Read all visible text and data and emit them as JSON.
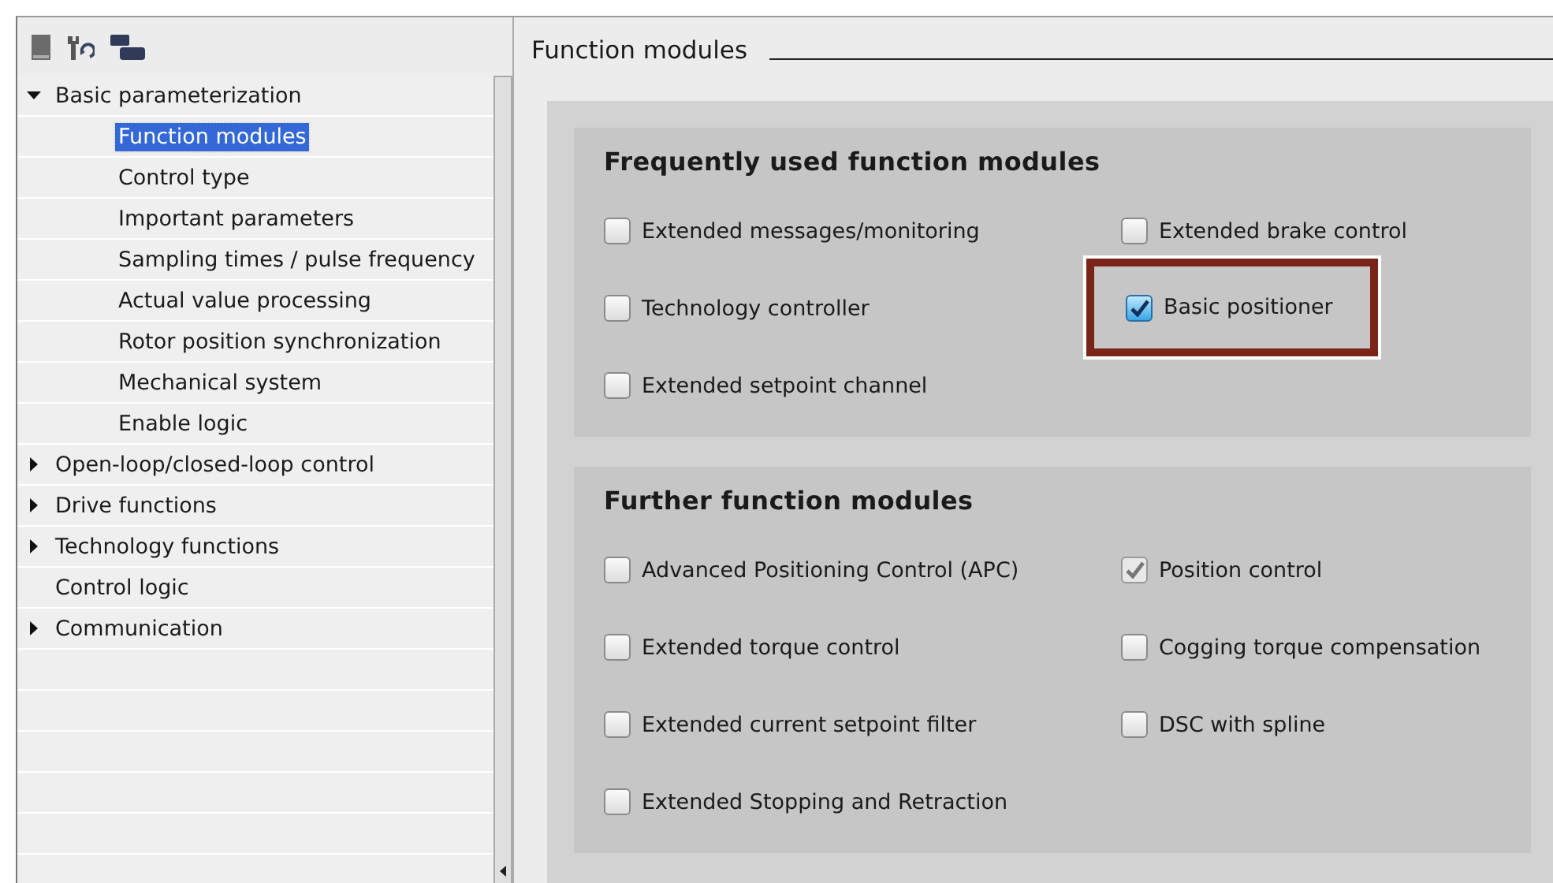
{
  "toolbar": {
    "buttons": [
      {
        "kind": "card"
      },
      {
        "kind": "wrench"
      },
      {
        "kind": "blocks"
      }
    ]
  },
  "tree": {
    "items": [
      {
        "label": "Basic parameterization",
        "expanded": true,
        "selected": false,
        "children": [
          {
            "label": "Function modules",
            "selected": true
          },
          {
            "label": "Control type",
            "selected": false
          },
          {
            "label": "Important parameters",
            "selected": false
          },
          {
            "label": "Sampling times / pulse frequency",
            "selected": false
          },
          {
            "label": "Actual value processing",
            "selected": false
          },
          {
            "label": "Rotor position synchronization",
            "selected": false
          },
          {
            "label": "Mechanical system",
            "selected": false
          },
          {
            "label": "Enable logic",
            "selected": false
          }
        ]
      },
      {
        "label": "Open-loop/closed-loop control",
        "expanded": false,
        "selected": false
      },
      {
        "label": "Drive functions",
        "expanded": false,
        "selected": false
      },
      {
        "label": "Technology functions",
        "expanded": false,
        "selected": false
      },
      {
        "label": "Control logic",
        "selected": false
      },
      {
        "label": "Communication",
        "expanded": false,
        "selected": false
      }
    ]
  },
  "section_title": "Function modules",
  "groups": [
    {
      "title": "Frequently used function modules",
      "options": [
        {
          "label": "Extended messages/monitoring",
          "checked": false,
          "disabled": false,
          "highlighted": false
        },
        {
          "label": "Extended brake control",
          "checked": false,
          "disabled": false,
          "highlighted": false
        },
        {
          "label": "Technology controller",
          "checked": false,
          "disabled": false,
          "highlighted": false
        },
        {
          "label": "Basic positioner",
          "checked": true,
          "disabled": false,
          "highlighted": true
        },
        {
          "label": "Extended setpoint channel",
          "checked": false,
          "disabled": false,
          "highlighted": false
        }
      ]
    },
    {
      "title": "Further function modules",
      "options": [
        {
          "label": "Advanced Positioning Control (APC)",
          "checked": false,
          "disabled": false,
          "highlighted": false
        },
        {
          "label": "Position control",
          "checked": true,
          "disabled": true,
          "highlighted": false
        },
        {
          "label": "Extended torque control",
          "checked": false,
          "disabled": false,
          "highlighted": false
        },
        {
          "label": "Cogging torque compensation",
          "checked": false,
          "disabled": false,
          "highlighted": false
        },
        {
          "label": "Extended current setpoint filter",
          "checked": false,
          "disabled": false,
          "highlighted": false
        },
        {
          "label": "DSC with spline",
          "checked": false,
          "disabled": false,
          "highlighted": false
        },
        {
          "label": "Extended Stopping and Retraction",
          "checked": false,
          "disabled": false,
          "highlighted": false
        }
      ]
    }
  ]
}
